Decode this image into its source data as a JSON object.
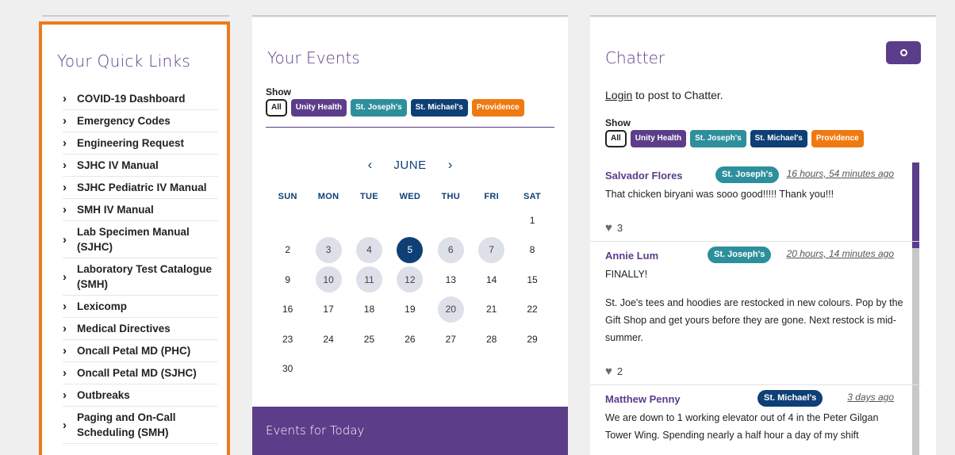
{
  "quick_links": {
    "title": "Your Quick Links",
    "items": [
      {
        "label": "COVID-19 Dashboard"
      },
      {
        "label": "Emergency Codes"
      },
      {
        "label": "Engineering Request"
      },
      {
        "label": "SJHC IV Manual"
      },
      {
        "label": "SJHC Pediatric IV Manual"
      },
      {
        "label": "SMH IV Manual"
      },
      {
        "label": "Lab Specimen Manual (SJHC)"
      },
      {
        "label": "Laboratory Test Catalogue (SMH)"
      },
      {
        "label": "Lexicomp"
      },
      {
        "label": "Medical Directives"
      },
      {
        "label": "Oncall Petal MD (PHC)"
      },
      {
        "label": "Oncall Petal MD (SJHC)"
      },
      {
        "label": "Outbreaks"
      },
      {
        "label": "Paging and On-Call Scheduling (SMH)"
      }
    ]
  },
  "events": {
    "title": "Your Events",
    "show_label": "Show",
    "filters": {
      "all": "All",
      "unity": "Unity Health",
      "stjoe": "St. Joseph's",
      "stmike": "St. Michael's",
      "prov": "Providence"
    },
    "month": "JUNE",
    "weekdays": [
      "SUN",
      "MON",
      "TUE",
      "WED",
      "THU",
      "FRI",
      "SAT"
    ],
    "days": {
      "d1": "1",
      "d2": "2",
      "d3": "3",
      "d4": "4",
      "d5": "5",
      "d6": "6",
      "d7": "7",
      "d8": "8",
      "d9": "9",
      "d10": "10",
      "d11": "11",
      "d12": "12",
      "d13": "13",
      "d14": "14",
      "d15": "15",
      "d16": "16",
      "d17": "17",
      "d18": "18",
      "d19": "19",
      "d20": "20",
      "d21": "21",
      "d22": "22",
      "d23": "23",
      "d24": "24",
      "d25": "25",
      "d26": "26",
      "d27": "27",
      "d28": "28",
      "d29": "29",
      "d30": "30"
    },
    "today_title": "Events for Today"
  },
  "chatter": {
    "title": "Chatter",
    "login_link": "Login",
    "login_rest": " to post to Chatter.",
    "show_label": "Show",
    "filters": {
      "all": "All",
      "unity": "Unity Health",
      "stjoe": "St. Joseph's",
      "stmike": "St. Michael's",
      "prov": "Providence"
    },
    "posts": [
      {
        "author": "Salvador Flores",
        "site": "St. Joseph's",
        "time": "16 hours, 54 minutes ago",
        "body1": "That chicken biryani was sooo good!!!!! Thank you!!!",
        "likes": "3"
      },
      {
        "author": "Annie Lum",
        "site": "St. Joseph's",
        "time": "20 hours, 14 minutes ago",
        "body1": "FINALLY!",
        "body2": "St. Joe's tees and hoodies are restocked in new colours. Pop by the Gift Shop and get yours before they are gone. Next restock is mid-summer.",
        "likes": "2"
      },
      {
        "author": "Matthew Penny",
        "site": "St. Michael's",
        "time": "3 days ago",
        "body1": "We are down to 1 working elevator out of 4 in the Peter Gilgan Tower Wing. Spending nearly a half hour a day of my shift"
      }
    ]
  },
  "colors": {
    "brand_purple": "#5b3d8a",
    "teal": "#2d8f9c",
    "navy": "#0e3f75",
    "orange": "#ef7a11",
    "quick_links_border": "#ec7a1c"
  }
}
